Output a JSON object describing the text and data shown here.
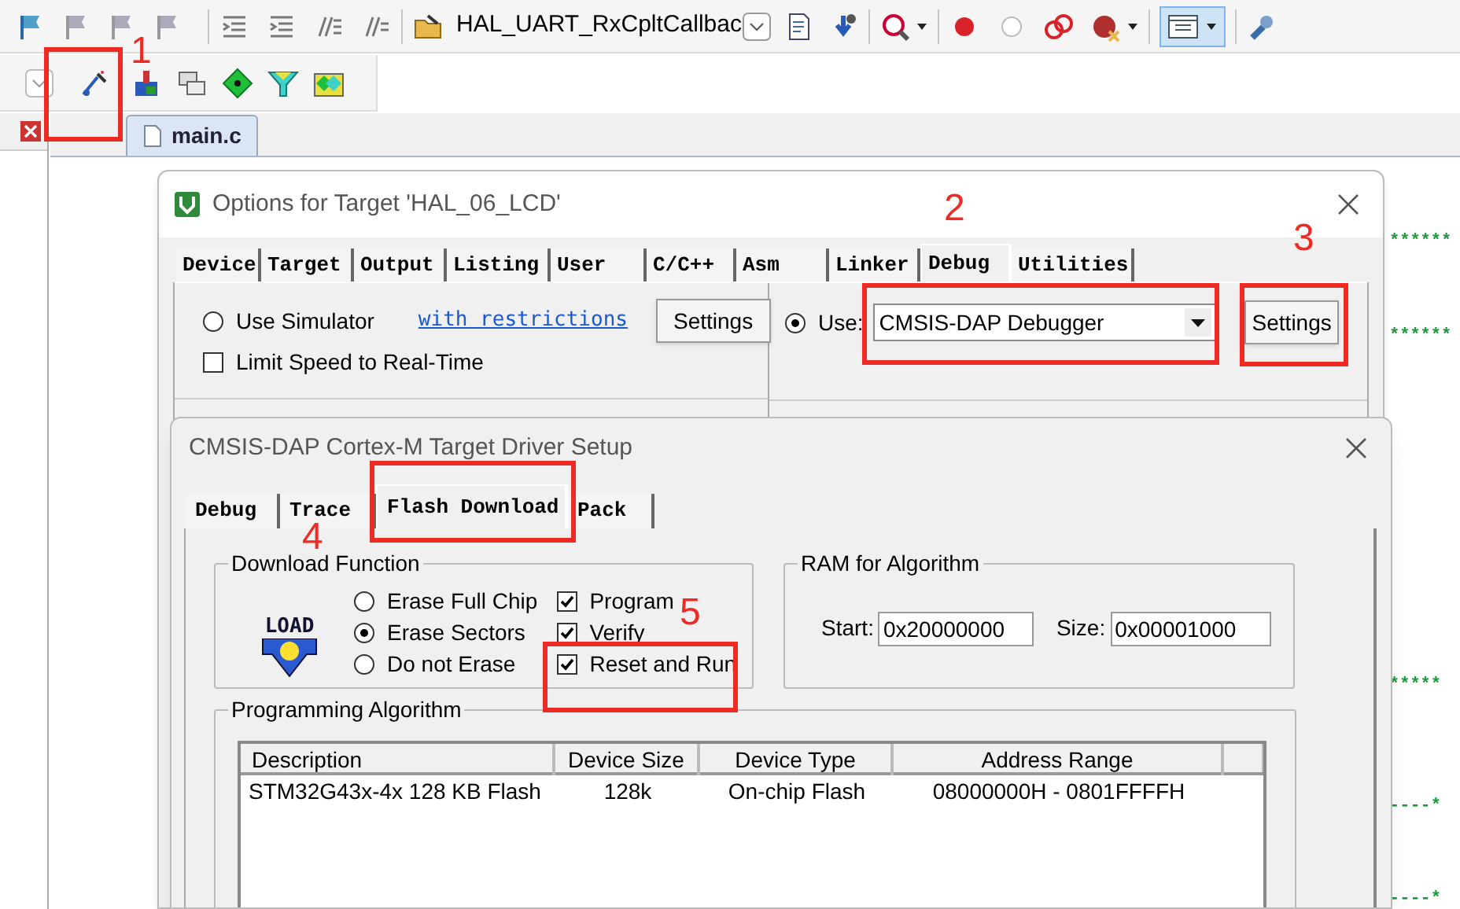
{
  "toolbar": {
    "function_combo": "HAL_UART_RxCpltCallbac"
  },
  "editor": {
    "tabs": [
      {
        "label": "main.c",
        "selected": true
      }
    ],
    "code_fragments": [
      "******",
      "******",
      "*****",
      "----*",
      "----*"
    ]
  },
  "options_dialog": {
    "title": "Options for Target 'HAL_06_LCD'",
    "tabs": [
      {
        "label": "Device",
        "selected": false
      },
      {
        "label": "Target",
        "selected": false
      },
      {
        "label": "Output",
        "selected": false
      },
      {
        "label": "Listing",
        "selected": false
      },
      {
        "label": "User",
        "selected": false
      },
      {
        "label": "C/C++",
        "selected": false
      },
      {
        "label": "Asm",
        "selected": false
      },
      {
        "label": "Linker",
        "selected": false
      },
      {
        "label": "Debug",
        "selected": true
      },
      {
        "label": "Utilities",
        "selected": false
      }
    ],
    "simulator": {
      "label": "Use Simulator",
      "selected": false
    },
    "restrictions_link": "with restrictions",
    "simulator_settings": "Settings",
    "limit_speed": {
      "label": "Limit Speed to Real-Time",
      "checked": false
    },
    "use": {
      "label": "Use:",
      "selected": true
    },
    "debugger": "CMSIS-DAP Debugger",
    "debugger_settings": "Settings"
  },
  "driver_dialog": {
    "title": "CMSIS-DAP Cortex-M Target Driver Setup",
    "tabs": [
      {
        "label": "Debug",
        "selected": false
      },
      {
        "label": "Trace",
        "selected": false
      },
      {
        "label": "Flash Download",
        "selected": true
      },
      {
        "label": "Pack",
        "selected": false
      }
    ],
    "download_function": {
      "title": "Download Function",
      "icon_text": "LOAD",
      "erase": [
        {
          "label": "Erase Full Chip",
          "selected": false
        },
        {
          "label": "Erase Sectors",
          "selected": true
        },
        {
          "label": "Do not Erase",
          "selected": false
        }
      ],
      "options": [
        {
          "label": "Program",
          "checked": true
        },
        {
          "label": "Verify",
          "checked": true
        },
        {
          "label": "Reset and Run",
          "checked": true
        }
      ]
    },
    "ram": {
      "title": "RAM for Algorithm",
      "start_label": "Start:",
      "start": "0x20000000",
      "size_label": "Size:",
      "size": "0x00001000"
    },
    "algorithm": {
      "title": "Programming Algorithm",
      "columns": [
        "Description",
        "Device Size",
        "Device Type",
        "Address Range"
      ],
      "rows": [
        [
          "STM32G43x-4x 128 KB Flash",
          "128k",
          "On-chip Flash",
          "08000000H - 0801FFFFH"
        ]
      ]
    }
  },
  "annotations": [
    {
      "label": "1"
    },
    {
      "label": "2"
    },
    {
      "label": "3"
    },
    {
      "label": "4"
    },
    {
      "label": "5"
    }
  ]
}
